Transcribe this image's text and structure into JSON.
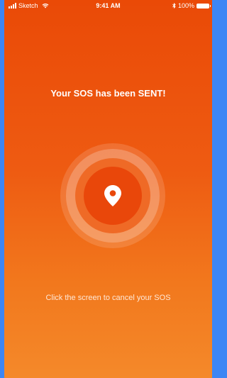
{
  "status_bar": {
    "carrier": "Sketch",
    "time": "9:41 AM",
    "battery": "100%",
    "icons": [
      "signal-icon",
      "wifi-icon",
      "bluetooth-icon",
      "battery-icon"
    ]
  },
  "sos": {
    "title": "Your SOS has been SENT!",
    "icon": "location-pin-icon",
    "cancel_hint": "Click the screen to cancel your SOS"
  },
  "colors": {
    "frame": "#3d86f4",
    "gradient_top": "#ea4a07",
    "gradient_bottom": "#f4892a",
    "inner_circle": "#e9470a",
    "text": "#ffffff"
  }
}
